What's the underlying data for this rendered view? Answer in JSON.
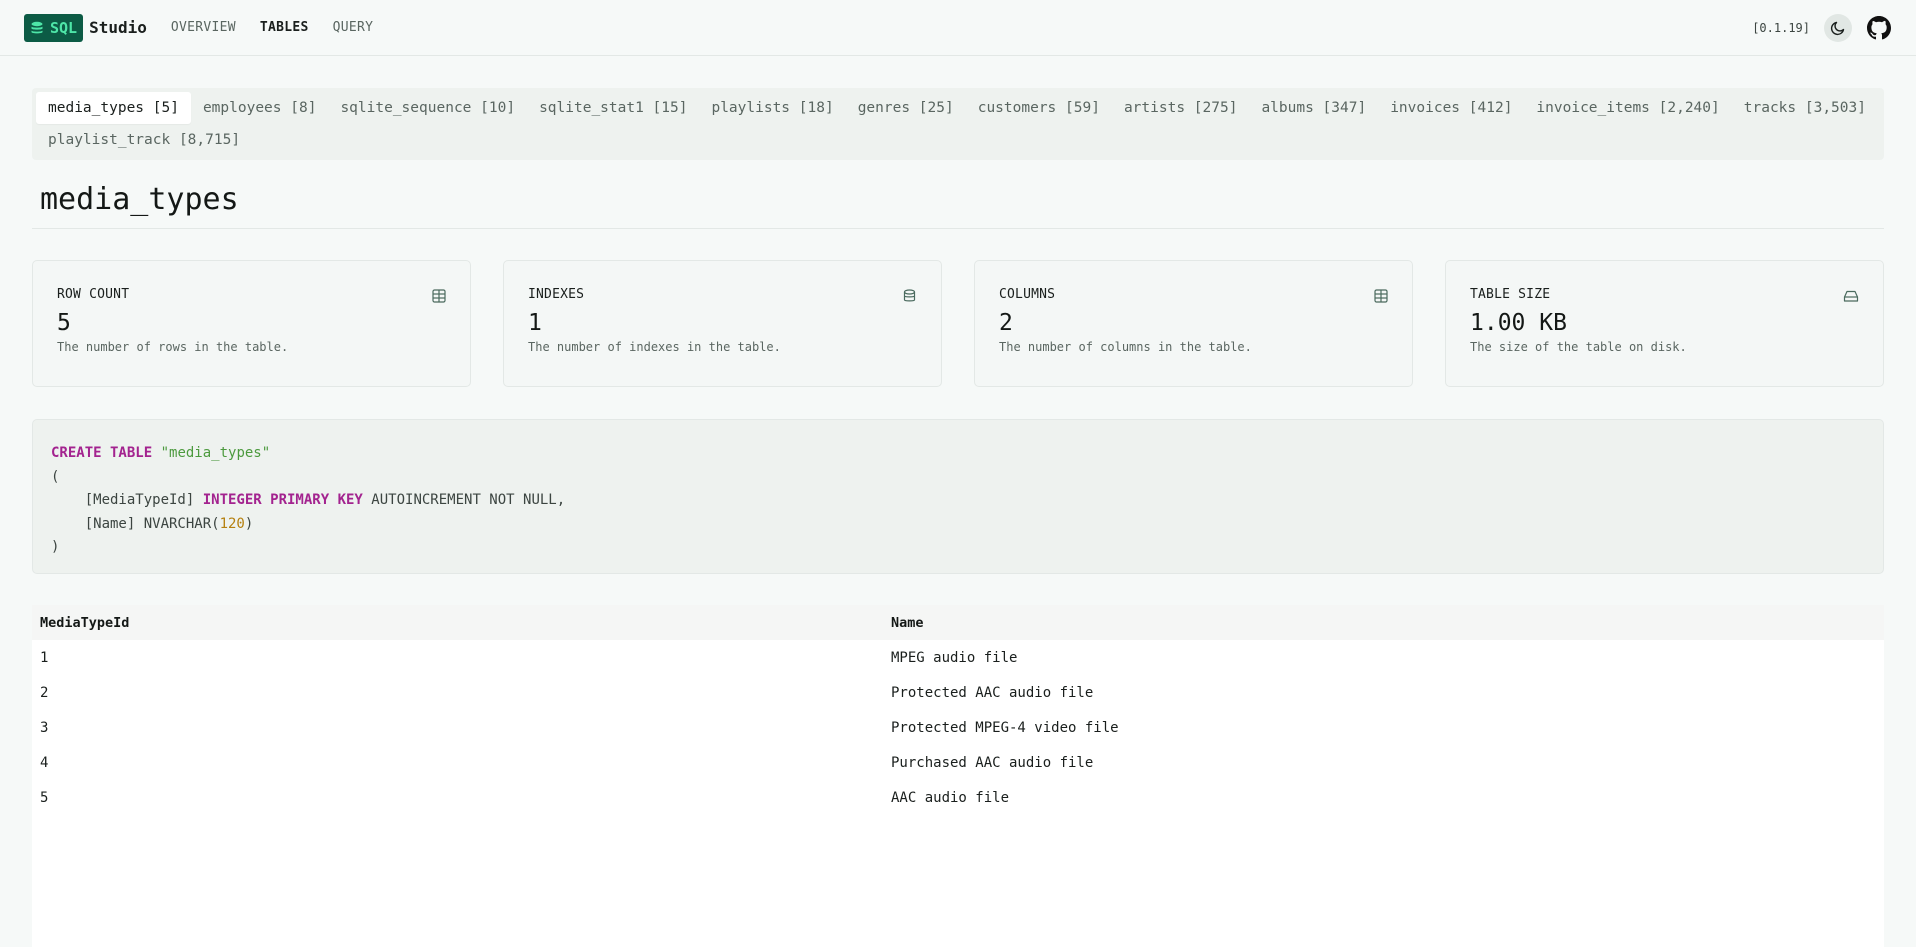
{
  "header": {
    "logo_badge": "SQL",
    "logo_text": "Studio",
    "nav": [
      "OVERVIEW",
      "TABLES",
      "QUERY"
    ],
    "active_nav": "TABLES",
    "version": "[0.1.19]"
  },
  "tabs": [
    "media_types [5]",
    "employees [8]",
    "sqlite_sequence [10]",
    "sqlite_stat1 [15]",
    "playlists [18]",
    "genres [25]",
    "customers [59]",
    "artists [275]",
    "albums [347]",
    "invoices [412]",
    "invoice_items [2,240]",
    "tracks [3,503]",
    "playlist_track [8,715]"
  ],
  "active_tab": "media_types [5]",
  "title": "media_types",
  "cards": [
    {
      "label": "ROW COUNT",
      "value": "5",
      "desc": "The number of rows in the table.",
      "icon": "table-icon"
    },
    {
      "label": "INDEXES",
      "value": "1",
      "desc": "The number of indexes in the table.",
      "icon": "database-icon"
    },
    {
      "label": "COLUMNS",
      "value": "2",
      "desc": "The number of columns in the table.",
      "icon": "table-icon"
    },
    {
      "label": "TABLE SIZE",
      "value": "1.00 KB",
      "desc": "The size of the table on disk.",
      "icon": "hard-drive-icon"
    }
  ],
  "sql": {
    "l1_kw": "CREATE TABLE",
    "l1_name": "\"media_types\"",
    "l2": "(",
    "l3_a": "    [MediaTypeId] ",
    "l3_kw": "INTEGER PRIMARY KEY",
    "l3_b": " AUTOINCREMENT NOT NULL,",
    "l4_a": "    [Name] NVARCHAR(",
    "l4_num": "120",
    "l4_b": ")",
    "l5": ")"
  },
  "table": {
    "columns": [
      "MediaTypeId",
      "Name"
    ],
    "rows": [
      [
        "1",
        "MPEG audio file"
      ],
      [
        "2",
        "Protected AAC audio file"
      ],
      [
        "3",
        "Protected MPEG-4 video file"
      ],
      [
        "4",
        "Purchased AAC audio file"
      ],
      [
        "5",
        "AAC audio file"
      ]
    ]
  },
  "colors": {
    "brand_bg": "#0c5b45",
    "brand_fg": "#4ee6a8",
    "keyword": "#a3238f",
    "string": "#4c9a3e",
    "number": "#b5800f"
  }
}
